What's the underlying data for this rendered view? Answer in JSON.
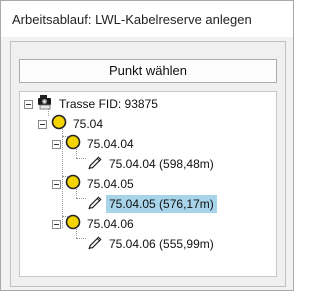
{
  "window": {
    "title": "Arbeitsablauf: LWL-Kabelreserve anlegen"
  },
  "toolbar": {
    "pick_point_label": "Punkt wählen"
  },
  "tree": {
    "root": {
      "label": "Trasse FID: 93875",
      "icon": "camera-station-icon"
    },
    "level1": {
      "label": "75.04",
      "icon": "yellow-circle-icon"
    },
    "groups": [
      {
        "label": "75.04.04",
        "icon": "yellow-circle-icon",
        "child": {
          "label": "75.04.04 (598,48m)",
          "icon": "pencil-icon"
        }
      },
      {
        "label": "75.04.05",
        "icon": "yellow-circle-icon",
        "child": {
          "label": "75.04.05 (576,17m)",
          "icon": "pencil-icon",
          "selected": true
        }
      },
      {
        "label": "75.04.06",
        "icon": "yellow-circle-icon",
        "child": {
          "label": "75.04.06 (555,99m)",
          "icon": "pencil-icon"
        }
      }
    ]
  },
  "colors": {
    "selection": "#a8d4ea",
    "node_fill": "#f5d300"
  }
}
